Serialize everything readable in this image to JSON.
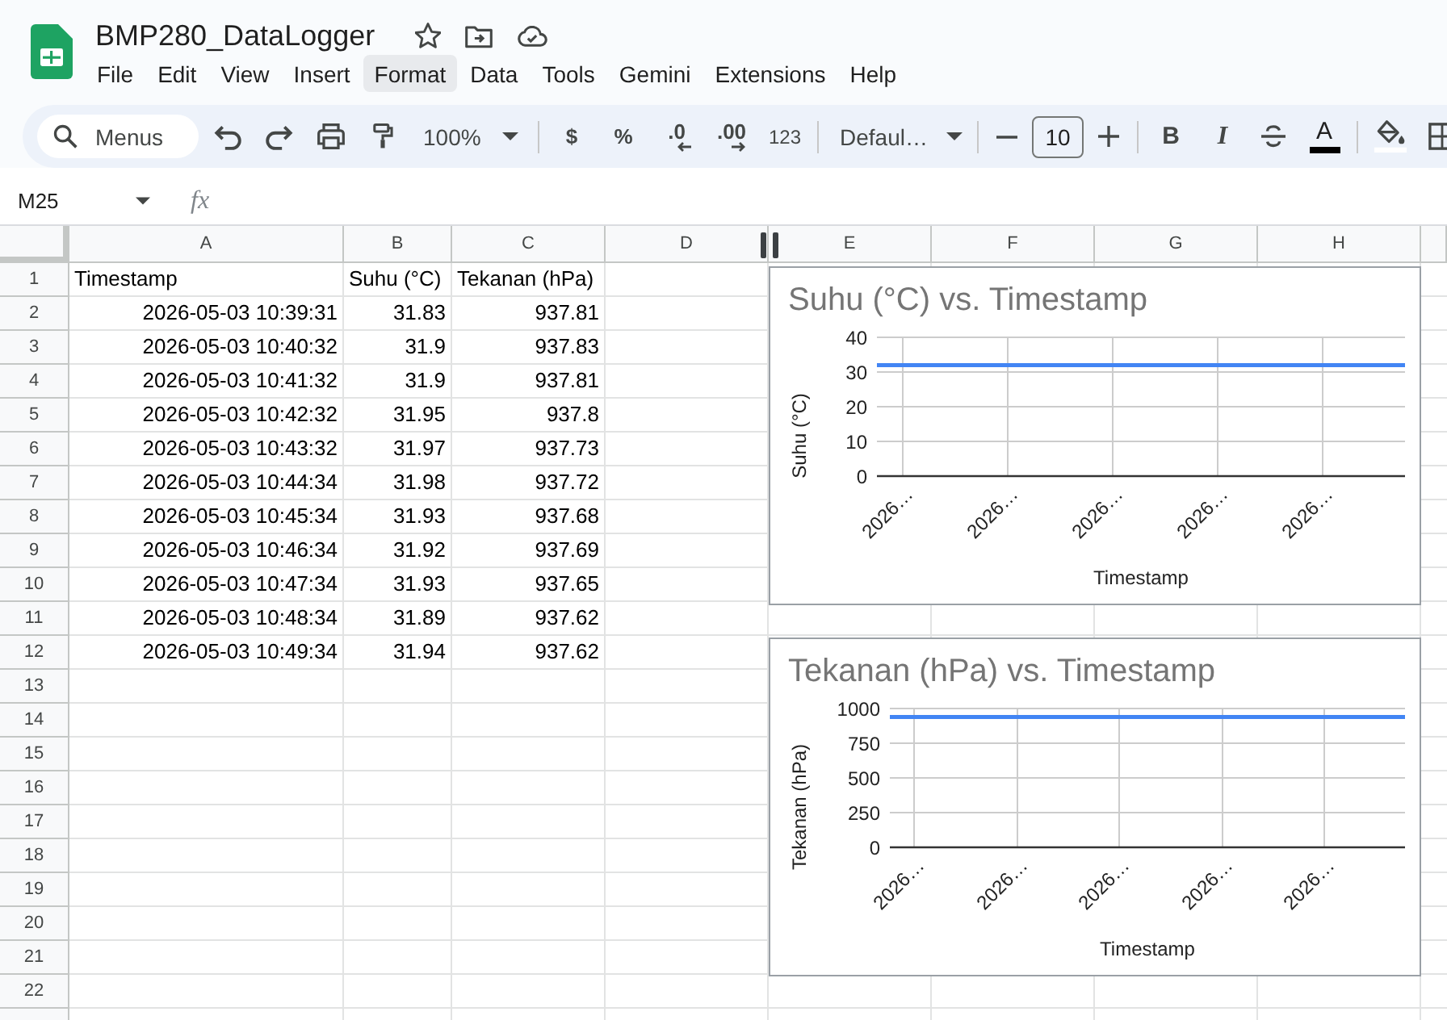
{
  "app": {
    "title": "BMP280_DataLogger"
  },
  "menu": [
    {
      "label": "File",
      "selected": false
    },
    {
      "label": "Edit",
      "selected": false
    },
    {
      "label": "View",
      "selected": false
    },
    {
      "label": "Insert",
      "selected": false
    },
    {
      "label": "Format",
      "selected": true
    },
    {
      "label": "Data",
      "selected": false
    },
    {
      "label": "Tools",
      "selected": false
    },
    {
      "label": "Gemini",
      "selected": false
    },
    {
      "label": "Extensions",
      "selected": false
    },
    {
      "label": "Help",
      "selected": false
    }
  ],
  "toolbar": {
    "search": {
      "placeholder": "Menus"
    },
    "zoom": "100%",
    "currency": "$",
    "percent": "%",
    "decrease_decimal": ".0",
    "increase_decimal": ".00",
    "number_format": "123",
    "font": "Defaul…",
    "font_size": "10",
    "bold": "B",
    "italic": "I",
    "text_color": "A"
  },
  "formula_bar": {
    "name_box": "M25",
    "fx": "fx"
  },
  "sheet": {
    "columns": [
      "A",
      "B",
      "C",
      "D",
      "E",
      "F",
      "G",
      "H"
    ],
    "row_numbers": [
      "1",
      "2",
      "3",
      "4",
      "5",
      "6",
      "7",
      "8",
      "9",
      "10",
      "11",
      "12",
      "13",
      "14",
      "15",
      "16",
      "17",
      "18",
      "19",
      "20",
      "21",
      "22"
    ],
    "header_row": [
      "Timestamp",
      "Suhu (°C)",
      "Tekanan (hPa)"
    ],
    "rows": [
      [
        "2026-05-03 10:39:31",
        "31.83",
        "937.81"
      ],
      [
        "2026-05-03 10:40:32",
        "31.9",
        "937.83"
      ],
      [
        "2026-05-03 10:41:32",
        "31.9",
        "937.81"
      ],
      [
        "2026-05-03 10:42:32",
        "31.95",
        "937.8"
      ],
      [
        "2026-05-03 10:43:32",
        "31.97",
        "937.73"
      ],
      [
        "2026-05-03 10:44:34",
        "31.98",
        "937.72"
      ],
      [
        "2026-05-03 10:45:34",
        "31.93",
        "937.68"
      ],
      [
        "2026-05-03 10:46:34",
        "31.92",
        "937.69"
      ],
      [
        "2026-05-03 10:47:34",
        "31.93",
        "937.65"
      ],
      [
        "2026-05-03 10:48:34",
        "31.89",
        "937.62"
      ],
      [
        "2026-05-03 10:49:34",
        "31.94",
        "937.62"
      ]
    ]
  },
  "charts": [
    {
      "chart_data": {
        "type": "line",
        "title": "Suhu (°C) vs. Timestamp",
        "xlabel": "Timestamp",
        "ylabel": "Suhu (°C)",
        "x": [
          "2026-05-03 10:39:31",
          "2026-05-03 10:40:32",
          "2026-05-03 10:41:32",
          "2026-05-03 10:42:32",
          "2026-05-03 10:43:32",
          "2026-05-03 10:44:34",
          "2026-05-03 10:45:34",
          "2026-05-03 10:46:34",
          "2026-05-03 10:47:34",
          "2026-05-03 10:48:34",
          "2026-05-03 10:49:34"
        ],
        "series": [
          {
            "color": "#4285f4",
            "values": [
              32,
              32,
              32,
              32,
              32,
              32,
              32,
              32,
              32,
              32,
              32
            ]
          }
        ],
        "xlim": [
          "2026-05-03 10:39:31",
          "2026-05-03 10:49:34"
        ],
        "ylim": [
          0,
          40
        ],
        "yticks": [
          0,
          10,
          20,
          30,
          40
        ],
        "xticks": [
          {
            "value": "2026-05-03 10:40:00",
            "label": "2026…"
          },
          {
            "value": "2026-05-03 10:42:00",
            "label": "2026…"
          },
          {
            "value": "2026-05-03 10:44:00",
            "label": "2026…"
          },
          {
            "value": "2026-05-03 10:46:00",
            "label": "2026…"
          },
          {
            "value": "2026-05-03 10:48:00",
            "label": "2026…"
          }
        ],
        "grid": true
      }
    },
    {
      "chart_data": {
        "type": "line",
        "title": "Tekanan (hPa) vs. Timestamp",
        "xlabel": "Timestamp",
        "ylabel": "Tekanan (hPa)",
        "x": [
          "2026-05-03 10:39:31",
          "2026-05-03 10:40:32",
          "2026-05-03 10:41:32",
          "2026-05-03 10:42:32",
          "2026-05-03 10:43:32",
          "2026-05-03 10:44:34",
          "2026-05-03 10:45:34",
          "2026-05-03 10:46:34",
          "2026-05-03 10:47:34",
          "2026-05-03 10:48:34",
          "2026-05-03 10:49:34"
        ],
        "series": [
          {
            "color": "#4285f4",
            "values": [
              940,
              940,
              940,
              940,
              940,
              940,
              940,
              940,
              940,
              940,
              940
            ]
          }
        ],
        "xlim": [
          "2026-05-03 10:39:31",
          "2026-05-03 10:49:34"
        ],
        "ylim": [
          0,
          1000
        ],
        "yticks": [
          0,
          250,
          500,
          750,
          1000
        ],
        "xticks": [
          {
            "value": "2026-05-03 10:40:00",
            "label": "2026…"
          },
          {
            "value": "2026-05-03 10:42:00",
            "label": "2026…"
          },
          {
            "value": "2026-05-03 10:44:00",
            "label": "2026…"
          },
          {
            "value": "2026-05-03 10:46:00",
            "label": "2026…"
          },
          {
            "value": "2026-05-03 10:48:00",
            "label": "2026…"
          }
        ],
        "grid": true
      }
    }
  ]
}
